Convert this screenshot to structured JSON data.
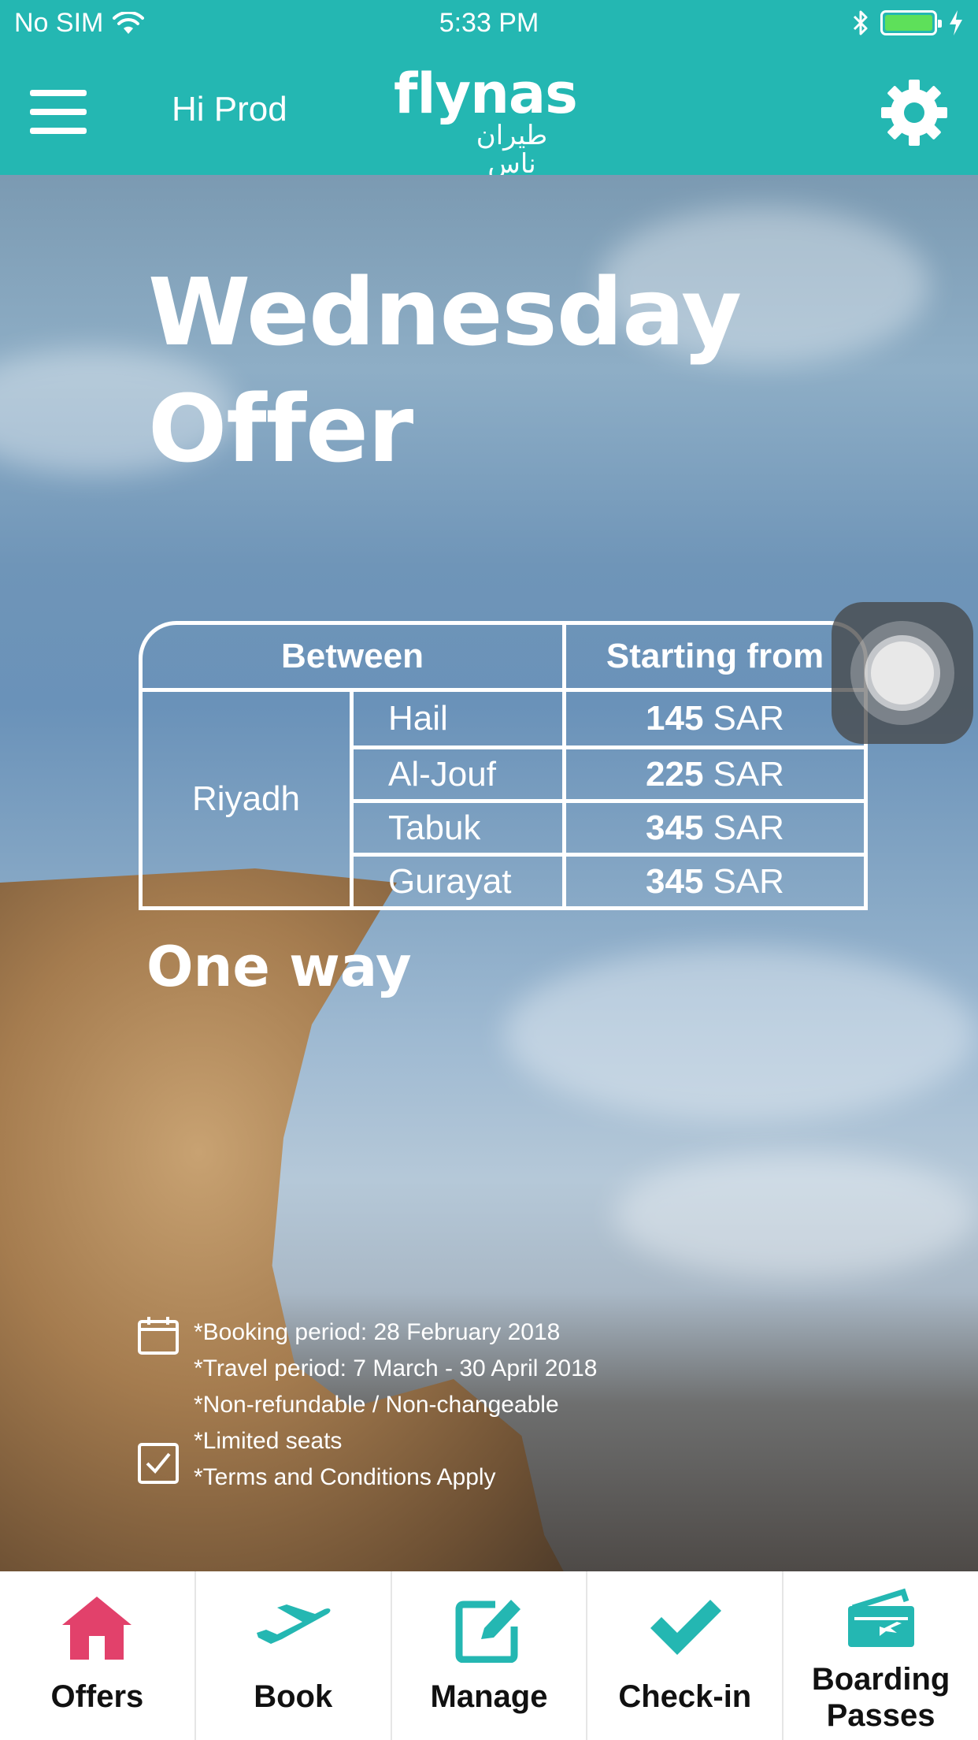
{
  "status_bar": {
    "carrier": "No SIM",
    "time": "5:33 PM",
    "battery_color": "#5ee05a"
  },
  "header": {
    "greeting": "Hi Prod",
    "logo_latin": "flynas",
    "logo_arabic": "طيران ناس",
    "menu_icon": "hamburger-icon",
    "settings_icon": "gear-icon",
    "bg_color": "#24b7b2"
  },
  "banner": {
    "title_line1": "Wednesday",
    "title_line2": "Offer",
    "table": {
      "header_between": "Between",
      "header_starting": "Starting from",
      "origin": "Riyadh",
      "routes": [
        {
          "destination": "Hail",
          "amount": "145",
          "currency": "SAR"
        },
        {
          "destination": "Al-Jouf",
          "amount": "225",
          "currency": "SAR"
        },
        {
          "destination": "Tabuk",
          "amount": "345",
          "currency": "SAR"
        },
        {
          "destination": "Gurayat",
          "amount": "345",
          "currency": "SAR"
        }
      ]
    },
    "trip_type": "One way",
    "terms": [
      "*Booking period: 28 February 2018",
      "*Travel period: 7 March - 30 April 2018",
      "*Non-refundable / Non-changeable",
      "*Limited seats",
      "*Terms and Conditions Apply"
    ]
  },
  "tabs": [
    {
      "label": "Offers",
      "icon": "house-icon",
      "color": "#e2416b"
    },
    {
      "label": "Book",
      "icon": "airplane-icon",
      "color": "#24b7b2"
    },
    {
      "label": "Manage",
      "icon": "edit-icon",
      "color": "#24b7b2"
    },
    {
      "label": "Check-in",
      "icon": "checkmark-icon",
      "color": "#24b7b2"
    },
    {
      "label_line1": "Boarding",
      "label_line2": "Passes",
      "icon": "ticket-icon",
      "color": "#24b7b2"
    }
  ]
}
